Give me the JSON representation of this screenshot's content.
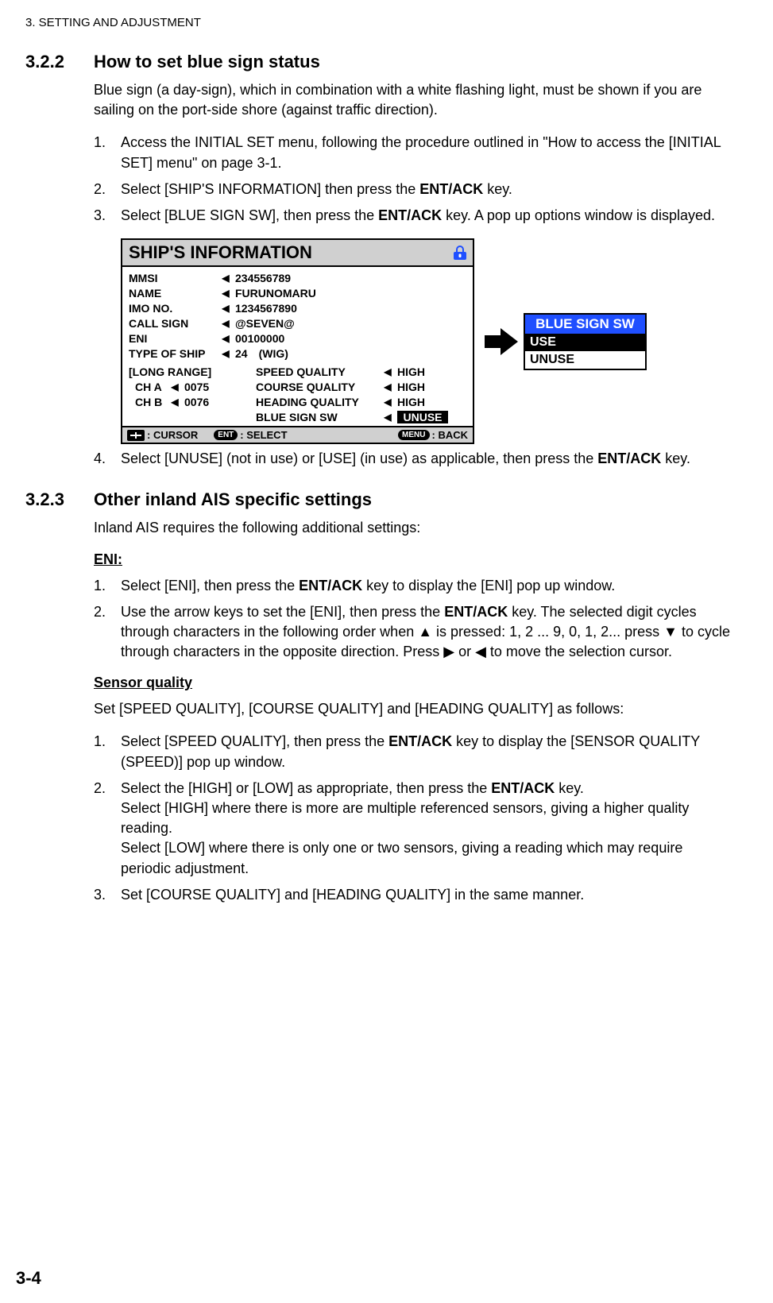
{
  "page_header": "3.  SETTING AND ADJUSTMENT",
  "sec_322": {
    "num": "3.2.2",
    "title": "How to set blue sign status",
    "intro": "Blue sign (a day-sign), which in combination with a white flashing light, must be shown if you are sailing on the port-side shore (against traffic direction).",
    "steps": {
      "s1": "Access the INITIAL SET menu, following the procedure outlined in \"How to access the [INITIAL SET] menu\" on page 3-1.",
      "s2_a": "Select [SHIP'S INFORMATION] then press the ",
      "s2_b": "ENT/ACK",
      "s2_c": " key.",
      "s3_a": "Select [BLUE SIGN SW], then press the ",
      "s3_b": "ENT/ACK",
      "s3_c": " key. A pop up options window is displayed.",
      "s4_a": "Select [UNUSE] (not in use) or [USE] (in use) as applicable, then press the ",
      "s4_b": "ENT/ACK",
      "s4_c": " key."
    }
  },
  "screen": {
    "title": "SHIP'S INFORMATION",
    "mmsi_l": "MMSI",
    "mmsi_v": "234556789",
    "name_l": "NAME",
    "name_v": "FURUNOMARU",
    "imo_l": "IMO NO.",
    "imo_v": "1234567890",
    "call_l": "CALL SIGN",
    "call_v": "@SEVEN@",
    "eni_l": "ENI",
    "eni_v": "00100000",
    "type_l": "TYPE OF SHIP",
    "type_v": "24 (WIG)",
    "long_range": "[LONG RANGE]",
    "cha_l": "CH A",
    "cha_v": "0075",
    "chb_l": "CH B",
    "chb_v": "0076",
    "sq_l": "SPEED QUALITY",
    "sq_v": "HIGH",
    "cq_l": "COURSE QUALITY",
    "cq_v": "HIGH",
    "hq_l": "HEADING QUALITY",
    "hq_v": "HIGH",
    "bs_l": "BLUE SIGN SW",
    "bs_v": "UNUSE",
    "f_cursor": ": CURSOR",
    "f_select": ": SELECT",
    "f_back": ": BACK",
    "f_ent": "ENT",
    "f_menu": "MENU"
  },
  "popup": {
    "title": "BLUE SIGN SW",
    "opt1": "USE",
    "opt2": "UNUSE"
  },
  "sec_323": {
    "num": "3.2.3",
    "title": "Other inland AIS specific settings",
    "intro": "Inland AIS requires the following additional settings:",
    "eni_h": "ENI:",
    "eni1_a": "Select [ENI], then press the ",
    "eni1_b": "ENT/ACK",
    "eni1_c": " key to display the [ENI] pop up window.",
    "eni2_a": " Use the arrow keys to set the [ENI], then press the ",
    "eni2_b": "ENT/ACK",
    "eni2_c": " key. The selected digit cycles through characters in the following order when ▲ is pressed: 1, 2 ... 9, 0, 1, 2... press ▼ to cycle through characters in the opposite direction. Press ▶ or ◀ to move the selection cursor.",
    "sq_h": "Sensor quality",
    "sq_intro": "Set [SPEED QUALITY], [COURSE QUALITY] and [HEADING QUALITY] as follows:",
    "sq1_a": "Select [SPEED QUALITY], then press the ",
    "sq1_b": "ENT/ACK",
    "sq1_c": " key to display the [SENSOR QUALITY (SPEED)] pop up window.",
    "sq2_a": "Select the [HIGH] or [LOW] as appropriate, then press the ",
    "sq2_b": "ENT/ACK",
    "sq2_c": " key.",
    "sq2_d": "Select [HIGH] where there is more are multiple referenced sensors, giving a higher quality reading.",
    "sq2_e": "Select [LOW] where there is only one or two sensors, giving a reading which may require periodic adjustment.",
    "sq3": "Set [COURSE QUALITY] and [HEADING QUALITY] in the same manner."
  },
  "page_num": "3-4"
}
